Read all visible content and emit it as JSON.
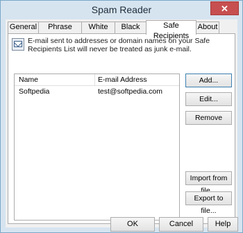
{
  "window": {
    "title": "Spam Reader",
    "close_glyph": "✕"
  },
  "tabs": [
    "General",
    "Phrase Filter",
    "White List",
    "Black List",
    "Safe Recipients",
    "About"
  ],
  "active_tab": "Safe Recipients",
  "panel": {
    "info_text": "E-mail sent to addresses or domain names on your Safe Recipients List will never be treated as junk e-mail.",
    "info_icon": "envelope-icon",
    "columns": [
      "Name",
      "E-mail Address"
    ],
    "rows": [
      {
        "name": "Softpedia",
        "email": "test@softpedia.com"
      }
    ],
    "buttons": {
      "add": "Add...",
      "edit": "Edit...",
      "remove": "Remove",
      "import": "Import from file...",
      "export": "Export to file..."
    }
  },
  "footer": {
    "ok": "OK",
    "cancel": "Cancel",
    "help": "Help"
  },
  "colors": {
    "frame": "#d6e4f0",
    "close": "#c74f4f",
    "accent": "#3c7fb1"
  }
}
